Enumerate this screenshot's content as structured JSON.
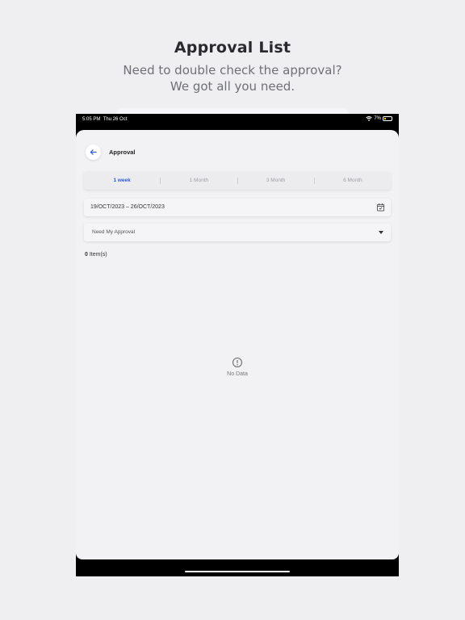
{
  "promo": {
    "title": "Approval List",
    "subtitle_line1": "Need to double check the approval?",
    "subtitle_line2": "We got all you need."
  },
  "status_bar": {
    "time": "5:05 PM",
    "date": "Thu 26 Oct",
    "battery": "7%"
  },
  "header": {
    "title": "Approval"
  },
  "tabs": [
    {
      "label": "1 week",
      "active": true
    },
    {
      "label": "1 Month",
      "active": false
    },
    {
      "label": "3 Month",
      "active": false
    },
    {
      "label": "6 Month",
      "active": false
    }
  ],
  "date_range": {
    "value": "19/OCT/2023 – 26/OCT/2023"
  },
  "filter": {
    "selected": "Need My Approval"
  },
  "item_count": {
    "count": "0",
    "suffix": "Item(s)"
  },
  "empty_state": {
    "text": "No Data"
  },
  "colors": {
    "accent": "#2d5bd4",
    "background": "#efeff1"
  }
}
